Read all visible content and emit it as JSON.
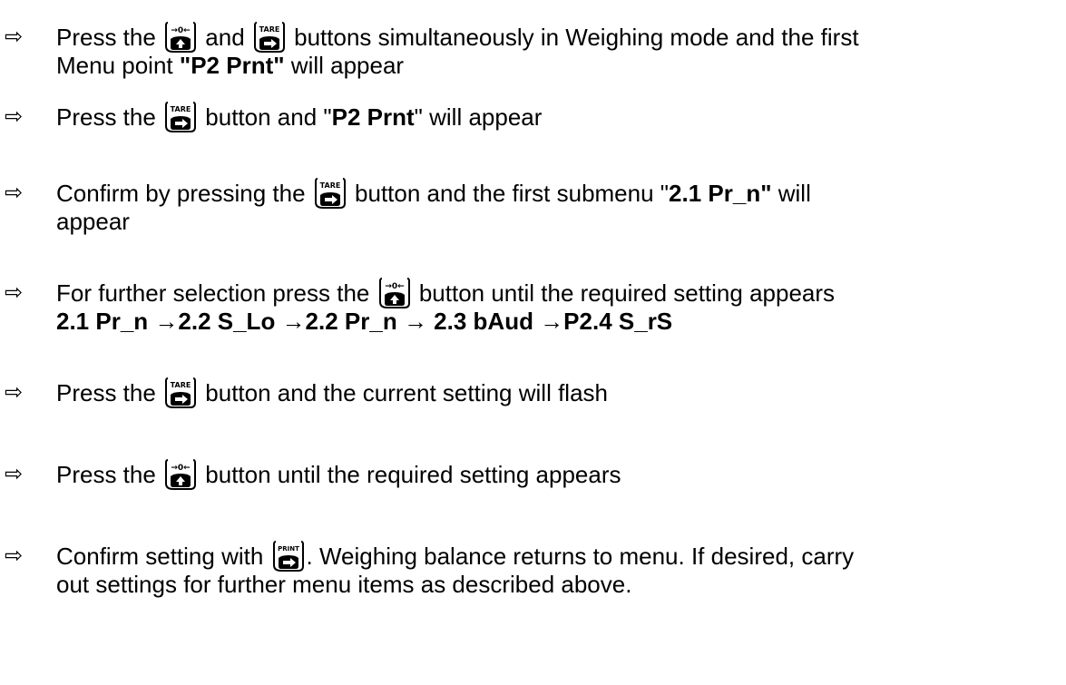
{
  "arrow_glyph": "⇨",
  "buttons": {
    "zero": {
      "label": "→0←",
      "icon": "zero-up-arrow"
    },
    "tare": {
      "label": "TARE",
      "icon": "tare-right-arrow"
    },
    "print": {
      "label": "PRINT",
      "icon": "print-right-arrow"
    }
  },
  "steps": [
    {
      "lines": [
        {
          "t1": "Press the ",
          "t2": " and ",
          "t3": " buttons simultaneously in Weighing mode and the first"
        },
        {
          "t1": "Menu point ",
          "b1": "\"P2 Prnt\"",
          "t2": " will appear"
        }
      ]
    },
    {
      "lines": [
        {
          "t1": "Press the ",
          "t2": "  button and \"",
          "b1": "P2 Prnt",
          "t3": "\" will appear"
        }
      ]
    },
    {
      "lines": [
        {
          "t1": "Confirm by pressing the ",
          "t2": " button and the first submenu \"",
          "b1": "2.1 Pr_n\"",
          "t3": " will"
        },
        {
          "t1": "appear"
        }
      ]
    },
    {
      "lines": [
        {
          "t1": "For further selection press the ",
          "t2": "  button until the required setting appears"
        },
        {
          "b1": "2.1 Pr_n →2.2 S_Lo →2.2 Pr_n → 2.3 bAud →P2.4 S_rS"
        }
      ]
    },
    {
      "lines": [
        {
          "t1": "Press the ",
          "t2": " button and the current setting will flash"
        }
      ]
    },
    {
      "lines": [
        {
          "t1": "Press the ",
          "t2": "  button until the required setting appears"
        }
      ]
    },
    {
      "lines": [
        {
          "t1": "Confirm setting with ",
          "t2": ". Weighing balance returns to menu. If desired, carry"
        },
        {
          "t1": "out settings for further menu items as described above."
        }
      ]
    }
  ]
}
